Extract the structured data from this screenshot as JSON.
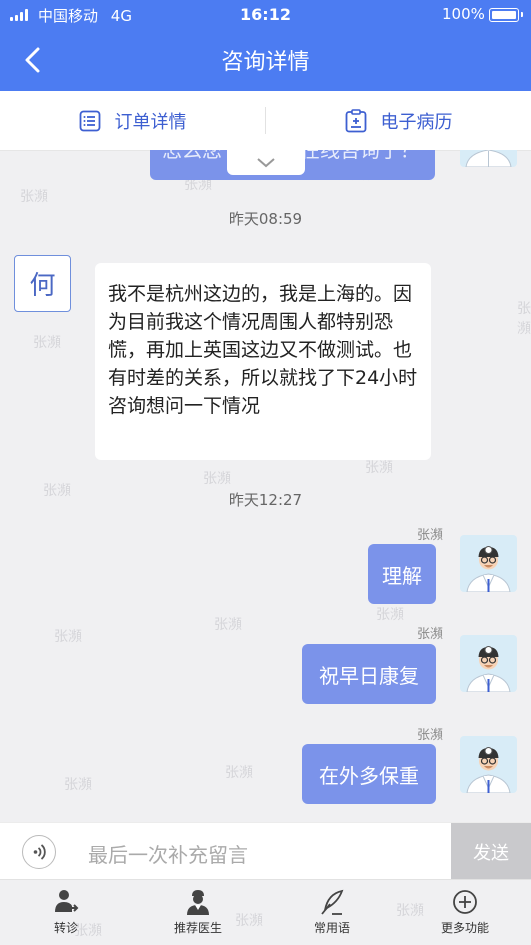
{
  "status_bar": {
    "carrier": "中国移动",
    "network": "4G",
    "time": "16:12",
    "battery": "100%"
  },
  "header": {
    "title": "咨询详情"
  },
  "tabs": [
    {
      "label": "订单详情",
      "icon": "list-icon"
    },
    {
      "label": "电子病历",
      "icon": "medical-record-icon"
    }
  ],
  "watermark": "张瀕",
  "messages": {
    "partial_top": "怎么您",
    "partial_top_tail": "在线咨询了？",
    "timestamp_1": "昨天08:59",
    "patient_avatar_char": "何",
    "patient_message": "我不是杭州这边的，我是上海的。因为目前我这个情况周围人都特别恐慌，再加上英国这边又不做测试。也有时差的关系，所以就找了下24小时咨询想问一下情况",
    "timestamp_2": "昨天12:27",
    "doctor_messages": [
      {
        "sender": "张瀕",
        "text": "理解"
      },
      {
        "sender": "张瀕",
        "text": "祝早日康复"
      },
      {
        "sender": "张瀕",
        "text": "在外多保重"
      }
    ]
  },
  "input": {
    "placeholder": "最后一次补充留言",
    "send_label": "发送"
  },
  "bottom_nav": [
    {
      "label": "转诊",
      "icon": "transfer-icon"
    },
    {
      "label": "推荐医生",
      "icon": "doctor-icon"
    },
    {
      "label": "常用语",
      "icon": "quill-icon"
    },
    {
      "label": "更多功能",
      "icon": "plus-circle-icon"
    }
  ],
  "colors": {
    "primary": "#4c7cf2",
    "bubble": "#7b93ea",
    "send_disabled": "#c9c9cc"
  }
}
